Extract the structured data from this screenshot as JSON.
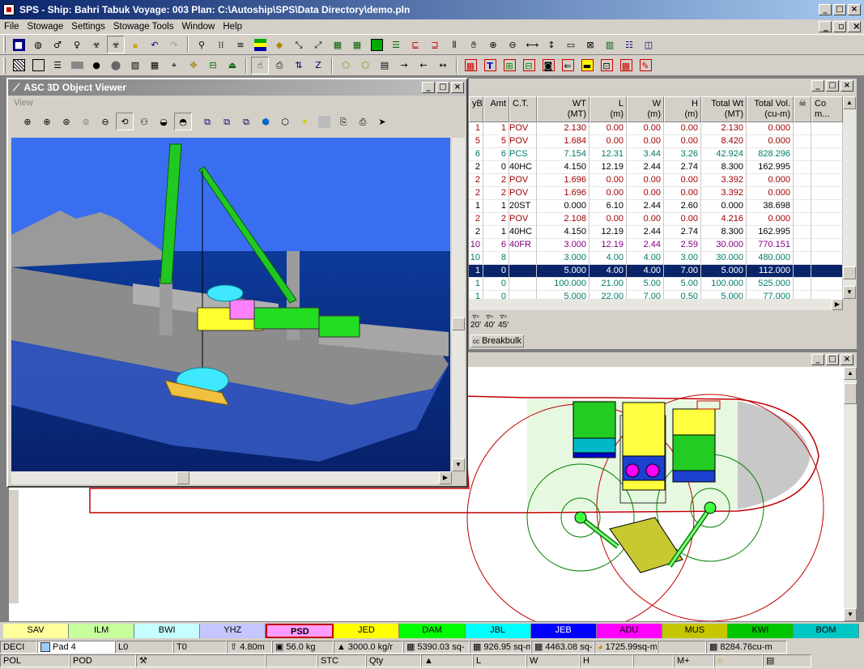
{
  "window": {
    "title": "SPS -  Ship: Bahri Tabuk     Voyage: 003     Plan: C:\\Autoship\\SPS\\Data Directory\\demo.pln"
  },
  "menu": [
    "File",
    "Stowage",
    "Settings",
    "Stowage Tools",
    "Window",
    "Help"
  ],
  "toolbar1": [
    "save-icon",
    "globe-icon",
    "male-icon",
    "female-icon",
    "biohazard-icon",
    "biohazard2-icon",
    "lock-icon",
    "undo-icon",
    "redo-icon",
    "separator",
    "search-icon",
    "columns-icon",
    "list-icon",
    "tiers-icon",
    "cargo-icon",
    "arrows-icon",
    "arrows2-icon",
    "grid-icon",
    "grid2-icon",
    "green-icon",
    "layers-icon",
    "deck-icon",
    "deck2-icon",
    "bars-icon",
    "hand-icon",
    "zoom-in-icon",
    "zoom-out-icon",
    "fit-horiz-icon",
    "fit-vert-icon",
    "window-icon",
    "close-window-icon",
    "table-icon",
    "table2-icon",
    "split-icon"
  ],
  "toolbar2": [
    "hatch-icon",
    "rect-icon",
    "list2-icon",
    "rect-solid-icon",
    "circle-icon",
    "cylinder-icon",
    "hatch2-icon",
    "grid3-icon",
    "crosshair-icon",
    "move-icon",
    "cargo2-icon",
    "crane-icon",
    "hand2-icon",
    "doc-icon",
    "arrows3-icon",
    "z-icon",
    "poly-icon",
    "poly2-icon",
    "notes-icon",
    "arrow-right-icon",
    "arrow-left-icon",
    "dimension-icon",
    "calc-icon",
    "text-icon",
    "grid4-icon",
    "cell-icon",
    "pad-icon",
    "left-icon",
    "tool-icon",
    "tool2-icon",
    "tool3-icon",
    "edit-icon"
  ],
  "grid": {
    "columns": [
      "yB",
      "Amt",
      "C.T.",
      "WT\n(MT)",
      "L\n(m)",
      "W\n(m)",
      "H\n(m)",
      "Total Wt\n(MT)",
      "Total Vol.\n(cu-m)",
      "",
      "Co\nm..."
    ],
    "rows": [
      [
        "1",
        "1",
        "POV",
        "2.130",
        "0.00",
        "0.00",
        "0.00",
        "2.130",
        "0.000",
        "#a00000"
      ],
      [
        "5",
        "5",
        "POV",
        "1.684",
        "0.00",
        "0.00",
        "0.00",
        "8.420",
        "0.000",
        "#a00000"
      ],
      [
        "6",
        "6",
        "PCS",
        "7.154",
        "12.31",
        "3.44",
        "3.26",
        "42.924",
        "828.296",
        "#007a6a"
      ],
      [
        "2",
        "0",
        "40HC",
        "4.150",
        "12.19",
        "2.44",
        "2.74",
        "8.300",
        "162.995",
        "#000000"
      ],
      [
        "2",
        "2",
        "POV",
        "1.696",
        "0.00",
        "0.00",
        "0.00",
        "3.392",
        "0.000",
        "#a00000"
      ],
      [
        "2",
        "2",
        "POV",
        "1.696",
        "0.00",
        "0.00",
        "0.00",
        "3.392",
        "0.000",
        "#a00000"
      ],
      [
        "1",
        "1",
        "20ST",
        "0.000",
        "6.10",
        "2.44",
        "2.60",
        "0.000",
        "38.698",
        "#000000"
      ],
      [
        "2",
        "2",
        "POV",
        "2.108",
        "0.00",
        "0.00",
        "0.00",
        "4.216",
        "0.000",
        "#a00000"
      ],
      [
        "2",
        "1",
        "40HC",
        "4.150",
        "12.19",
        "2.44",
        "2.74",
        "8.300",
        "162.995",
        "#000000"
      ],
      [
        "10",
        "6",
        "40FR",
        "3.000",
        "12.19",
        "2.44",
        "2.59",
        "30.000",
        "770.151",
        "#800080"
      ],
      [
        "10",
        "8",
        "",
        "3.000",
        "4.00",
        "4.00",
        "3.00",
        "30.000",
        "480.000",
        "#007a6a"
      ],
      [
        "1",
        "0",
        "",
        "5.000",
        "4.00",
        "4.00",
        "7.00",
        "5.000",
        "112.000",
        "#ffffff"
      ],
      [
        "1",
        "0",
        "",
        "100.000",
        "21.00",
        "5.00",
        "5.00",
        "100.000",
        "525.000",
        "#007a6a"
      ],
      [
        "1",
        "0",
        "",
        "5.000",
        "22.00",
        "7.00",
        "0.50",
        "5.000",
        "77.000",
        "#007a6a"
      ]
    ],
    "selected_row": 11,
    "container_sizes": [
      "20'",
      "40'",
      "45'"
    ],
    "breakbulk_label": "Breakbulk"
  },
  "viewer": {
    "title": "ASC 3D Object Viewer",
    "menu": "View"
  },
  "ports": [
    {
      "name": "SAV",
      "color": "#ffff9c"
    },
    {
      "name": "ILM",
      "color": "#c6ff9c"
    },
    {
      "name": "BWI",
      "color": "#c6ffff"
    },
    {
      "name": "YHZ",
      "color": "#c6c6ff"
    },
    {
      "name": "PSD",
      "color": "#ff9cff"
    },
    {
      "name": "JED",
      "color": "#ffff00"
    },
    {
      "name": "DAM",
      "color": "#00ff00"
    },
    {
      "name": "JBL",
      "color": "#00ffff"
    },
    {
      "name": "JEB",
      "color": "#0000ff"
    },
    {
      "name": "ADU",
      "color": "#ff00ff"
    },
    {
      "name": "MUS",
      "color": "#c6c600"
    },
    {
      "name": "KWI",
      "color": "#00c600"
    },
    {
      "name": "BOM",
      "color": "#00c6c6"
    }
  ],
  "status1": [
    "DECI",
    "Pad 4",
    "L0",
    "T0",
    "4.80m",
    "56.0 kg",
    "3000.0 kg/r",
    "5390.03 sq-",
    "926.95 sq-m",
    "4463.08 sq-",
    "1725.99sq-m",
    "",
    "8284.76cu-m"
  ],
  "status2": [
    "POL",
    "POD",
    "",
    "",
    "STC",
    "Qty",
    "",
    "L",
    "W",
    "H",
    "",
    "M+",
    "",
    ""
  ]
}
